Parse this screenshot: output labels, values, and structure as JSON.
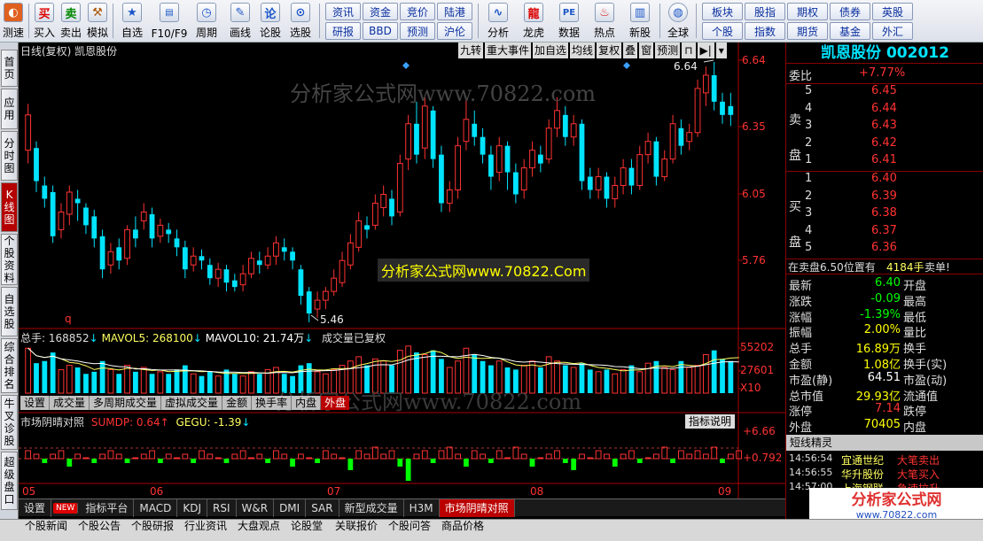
{
  "toolbar": {
    "left_buttons": [
      {
        "label": "测速",
        "icon": "speed-icon"
      },
      {
        "label": "买入",
        "icon": "buy-icon",
        "glyph": "买"
      },
      {
        "label": "卖出",
        "icon": "sell-icon",
        "glyph": "卖"
      },
      {
        "label": "模拟",
        "icon": "hammer-icon"
      },
      {
        "label": "自选",
        "icon": "star-icon"
      },
      {
        "label": "F10/F9",
        "icon": "f10-icon"
      },
      {
        "label": "周期",
        "icon": "clock-icon"
      },
      {
        "label": "画线",
        "icon": "pen-icon"
      },
      {
        "label": "论股",
        "icon": "discuss-icon",
        "glyph": "论"
      },
      {
        "label": "选股",
        "icon": "screen-stock-icon"
      }
    ],
    "panel1": [
      "资讯",
      "资金",
      "竞价",
      "陆港",
      "研报",
      "BBD",
      "预测",
      "沪伦"
    ],
    "mid_buttons": [
      {
        "label": "分析",
        "icon": "analysis-icon"
      },
      {
        "label": "龙虎",
        "icon": "dragon-tiger-icon"
      },
      {
        "label": "数据",
        "icon": "pe-data-icon",
        "glyph": "PE"
      },
      {
        "label": "热点",
        "icon": "hot-icon"
      },
      {
        "label": "新股",
        "icon": "new-stock-icon"
      },
      {
        "label": "全球",
        "icon": "globe-icon"
      }
    ],
    "panel2": [
      "板块",
      "股指",
      "期权",
      "债券",
      "英股",
      "个股",
      "指数",
      "期货",
      "基金",
      "外汇"
    ]
  },
  "left_tabs": [
    "首页",
    "应用",
    "分时图",
    "K线图",
    "个股资料",
    "自选股",
    "综合排名",
    "牛叉诊股",
    "超级盘口"
  ],
  "chart": {
    "title": "日线(复权) 凯恩股份",
    "top_buttons": [
      "九转",
      "重大事件",
      "加自选",
      "均线",
      "复权",
      "叠",
      "窗",
      "预测"
    ],
    "watermark1": "分析家公式网www.70822.com",
    "watermark2": "分析家公式网www.70822.Com",
    "watermark3": "分析家公式网www.70822.com",
    "price_labels": [
      "6.64",
      "6.35",
      "6.05",
      "5.76"
    ],
    "max_label": "6.64",
    "min_label": "5.46",
    "q_mark": "q",
    "vol_header": {
      "total": "总手: 168852",
      "mavol5": "MAVOL5: 268100",
      "mavol10": "MAVOL10: 21.74万",
      "note": "成交量已复权"
    },
    "vol_labels": [
      "55202",
      "27601",
      "X10"
    ],
    "vol_tabs": [
      "设置",
      "成交量",
      "多周期成交量",
      "虚拟成交量",
      "金额",
      "换手率",
      "内盘",
      "外盘"
    ],
    "ind_header": {
      "name": "市场阴晴对照",
      "sumdp": "SUMDP: 0.64",
      "gegu": "GEGU: -1.39"
    },
    "ind_button": "指标说明",
    "ind_labels": [
      "+6.66",
      "+0.792"
    ],
    "month_labels": [
      "05",
      "06",
      "07",
      "08",
      "09"
    ]
  },
  "chart_data": {
    "type": "candlestick",
    "ylim": [
      5.46,
      6.64
    ],
    "candles": [
      {
        "o": 6.24,
        "c": 6.4,
        "h": 6.45,
        "l": 6.18
      },
      {
        "o": 6.25,
        "c": 6.1,
        "h": 6.28,
        "l": 6.05
      },
      {
        "o": 6.08,
        "c": 6.02,
        "h": 6.12,
        "l": 5.98
      },
      {
        "o": 6.05,
        "c": 5.85,
        "h": 6.08,
        "l": 5.82
      },
      {
        "o": 5.88,
        "c": 5.96,
        "h": 6.0,
        "l": 5.84
      },
      {
        "o": 5.95,
        "c": 6.05,
        "h": 6.08,
        "l": 5.9
      },
      {
        "o": 6.02,
        "c": 6.0,
        "h": 6.06,
        "l": 5.92
      },
      {
        "o": 5.98,
        "c": 5.9,
        "h": 6.0,
        "l": 5.86
      },
      {
        "o": 5.94,
        "c": 5.84,
        "h": 5.97,
        "l": 5.8
      },
      {
        "o": 5.85,
        "c": 5.7,
        "h": 5.88,
        "l": 5.66
      },
      {
        "o": 5.72,
        "c": 5.78,
        "h": 5.82,
        "l": 5.68
      },
      {
        "o": 5.8,
        "c": 5.74,
        "h": 5.84,
        "l": 5.7
      },
      {
        "o": 5.75,
        "c": 5.88,
        "h": 5.9,
        "l": 5.72
      },
      {
        "o": 5.88,
        "c": 5.84,
        "h": 5.94,
        "l": 5.8
      },
      {
        "o": 5.92,
        "c": 5.96,
        "h": 6.0,
        "l": 5.88
      },
      {
        "o": 5.95,
        "c": 5.84,
        "h": 5.98,
        "l": 5.8
      },
      {
        "o": 5.85,
        "c": 5.9,
        "h": 5.93,
        "l": 5.82
      },
      {
        "o": 5.88,
        "c": 5.86,
        "h": 5.91,
        "l": 5.82
      },
      {
        "o": 5.84,
        "c": 5.8,
        "h": 5.88,
        "l": 5.76
      },
      {
        "o": 5.8,
        "c": 5.7,
        "h": 5.83,
        "l": 5.66
      },
      {
        "o": 5.72,
        "c": 5.76,
        "h": 5.8,
        "l": 5.69
      },
      {
        "o": 5.76,
        "c": 5.74,
        "h": 5.79,
        "l": 5.7
      },
      {
        "o": 5.72,
        "c": 5.66,
        "h": 5.75,
        "l": 5.63
      },
      {
        "o": 5.66,
        "c": 5.7,
        "h": 5.73,
        "l": 5.62
      },
      {
        "o": 5.7,
        "c": 5.64,
        "h": 5.72,
        "l": 5.6
      },
      {
        "o": 5.65,
        "c": 5.62,
        "h": 5.68,
        "l": 5.6
      },
      {
        "o": 5.63,
        "c": 5.68,
        "h": 5.72,
        "l": 5.6
      },
      {
        "o": 5.68,
        "c": 5.75,
        "h": 5.78,
        "l": 5.66
      },
      {
        "o": 5.74,
        "c": 5.72,
        "h": 5.78,
        "l": 5.68
      },
      {
        "o": 5.72,
        "c": 5.76,
        "h": 5.8,
        "l": 5.7
      },
      {
        "o": 5.76,
        "c": 5.82,
        "h": 5.85,
        "l": 5.72
      },
      {
        "o": 5.8,
        "c": 5.78,
        "h": 5.84,
        "l": 5.74
      },
      {
        "o": 5.78,
        "c": 5.74,
        "h": 5.8,
        "l": 5.7
      },
      {
        "o": 5.7,
        "c": 5.58,
        "h": 5.72,
        "l": 5.54
      },
      {
        "o": 5.6,
        "c": 5.5,
        "h": 5.62,
        "l": 5.46
      },
      {
        "o": 5.52,
        "c": 5.56,
        "h": 5.6,
        "l": 5.48
      },
      {
        "o": 5.56,
        "c": 5.6,
        "h": 5.62,
        "l": 5.52
      },
      {
        "o": 5.6,
        "c": 5.66,
        "h": 5.7,
        "l": 5.58
      },
      {
        "o": 5.64,
        "c": 5.74,
        "h": 5.78,
        "l": 5.62
      },
      {
        "o": 5.72,
        "c": 5.82,
        "h": 5.86,
        "l": 5.7
      },
      {
        "o": 5.8,
        "c": 5.92,
        "h": 5.96,
        "l": 5.78
      },
      {
        "o": 5.9,
        "c": 5.88,
        "h": 5.94,
        "l": 5.84
      },
      {
        "o": 5.9,
        "c": 6.0,
        "h": 6.04,
        "l": 5.88
      },
      {
        "o": 5.98,
        "c": 6.04,
        "h": 6.08,
        "l": 5.94
      },
      {
        "o": 6.02,
        "c": 5.94,
        "h": 6.06,
        "l": 5.9
      },
      {
        "o": 5.96,
        "c": 6.18,
        "h": 6.22,
        "l": 5.94
      },
      {
        "o": 6.2,
        "c": 6.36,
        "h": 6.4,
        "l": 6.15
      },
      {
        "o": 6.36,
        "c": 6.22,
        "h": 6.46,
        "l": 6.18
      },
      {
        "o": 6.25,
        "c": 6.44,
        "h": 6.48,
        "l": 6.2
      },
      {
        "o": 6.42,
        "c": 6.2,
        "h": 6.44,
        "l": 6.16
      },
      {
        "o": 6.22,
        "c": 6.0,
        "h": 6.26,
        "l": 5.96
      },
      {
        "o": 6.0,
        "c": 6.06,
        "h": 6.1,
        "l": 5.96
      },
      {
        "o": 6.06,
        "c": 6.26,
        "h": 6.3,
        "l": 6.02
      },
      {
        "o": 6.28,
        "c": 6.38,
        "h": 6.48,
        "l": 6.24
      },
      {
        "o": 6.36,
        "c": 6.3,
        "h": 6.42,
        "l": 6.26
      },
      {
        "o": 6.3,
        "c": 6.22,
        "h": 6.34,
        "l": 6.18
      },
      {
        "o": 6.22,
        "c": 6.12,
        "h": 6.26,
        "l": 6.06
      },
      {
        "o": 6.14,
        "c": 6.26,
        "h": 6.3,
        "l": 6.1
      },
      {
        "o": 6.26,
        "c": 6.14,
        "h": 6.28,
        "l": 6.06
      },
      {
        "o": 6.14,
        "c": 6.04,
        "h": 6.18,
        "l": 6.0
      },
      {
        "o": 6.06,
        "c": 6.16,
        "h": 6.2,
        "l": 6.02
      },
      {
        "o": 6.16,
        "c": 6.24,
        "h": 6.28,
        "l": 6.12
      },
      {
        "o": 6.22,
        "c": 6.18,
        "h": 6.26,
        "l": 6.14
      },
      {
        "o": 6.2,
        "c": 6.34,
        "h": 6.38,
        "l": 6.18
      },
      {
        "o": 6.34,
        "c": 6.42,
        "h": 6.48,
        "l": 6.3
      },
      {
        "o": 6.4,
        "c": 6.3,
        "h": 6.44,
        "l": 6.26
      },
      {
        "o": 6.3,
        "c": 6.36,
        "h": 6.4,
        "l": 6.26
      },
      {
        "o": 6.36,
        "c": 6.1,
        "h": 6.38,
        "l": 6.06
      },
      {
        "o": 6.12,
        "c": 6.06,
        "h": 6.16,
        "l": 6.02
      },
      {
        "o": 6.06,
        "c": 6.12,
        "h": 6.16,
        "l": 6.02
      },
      {
        "o": 6.12,
        "c": 6.02,
        "h": 6.14,
        "l": 5.98
      },
      {
        "o": 6.02,
        "c": 6.08,
        "h": 6.12,
        "l": 5.98
      },
      {
        "o": 6.08,
        "c": 6.16,
        "h": 6.2,
        "l": 6.04
      },
      {
        "o": 6.16,
        "c": 6.08,
        "h": 6.2,
        "l": 6.04
      },
      {
        "o": 6.08,
        "c": 6.22,
        "h": 6.26,
        "l": 6.06
      },
      {
        "o": 6.22,
        "c": 6.28,
        "h": 6.32,
        "l": 6.18
      },
      {
        "o": 6.28,
        "c": 6.12,
        "h": 6.3,
        "l": 6.08
      },
      {
        "o": 6.12,
        "c": 6.2,
        "h": 6.24,
        "l": 6.1
      },
      {
        "o": 6.2,
        "c": 6.36,
        "h": 6.4,
        "l": 6.18
      },
      {
        "o": 6.34,
        "c": 6.26,
        "h": 6.38,
        "l": 6.22
      },
      {
        "o": 6.28,
        "c": 6.32,
        "h": 6.36,
        "l": 6.24
      },
      {
        "o": 6.32,
        "c": 6.52,
        "h": 6.56,
        "l": 6.3
      },
      {
        "o": 6.5,
        "c": 6.58,
        "h": 6.62,
        "l": 6.44
      },
      {
        "o": 6.58,
        "c": 6.46,
        "h": 6.64,
        "l": 6.42
      },
      {
        "o": 6.46,
        "c": 6.4,
        "h": 6.5,
        "l": 6.36
      },
      {
        "o": 6.44,
        "c": 6.4,
        "h": 6.5,
        "l": 6.35
      }
    ],
    "volumes": [
      42,
      28,
      30,
      38,
      22,
      26,
      24,
      18,
      20,
      30,
      22,
      18,
      26,
      20,
      24,
      18,
      20,
      18,
      22,
      26,
      18,
      16,
      20,
      16,
      22,
      18,
      16,
      20,
      18,
      22,
      24,
      18,
      16,
      26,
      28,
      20,
      18,
      22,
      26,
      30,
      34,
      26,
      32,
      30,
      26,
      40,
      44,
      38,
      36,
      40,
      32,
      24,
      30,
      42,
      36,
      30,
      26,
      30,
      24,
      22,
      26,
      30,
      24,
      34,
      30,
      26,
      24,
      28,
      22,
      20,
      22,
      18,
      22,
      26,
      20,
      28,
      30,
      24,
      22,
      30,
      24,
      26,
      36,
      40,
      32,
      30,
      28
    ],
    "indicator": [
      2,
      1,
      -1,
      1,
      2,
      -2,
      1,
      0,
      -1,
      1,
      2,
      1,
      -1,
      0,
      1,
      2,
      -1,
      1,
      0,
      1,
      -1,
      2,
      1,
      0,
      -1,
      1,
      2,
      0,
      1,
      -1,
      2,
      1,
      -2,
      1,
      0,
      -1,
      2,
      1,
      0,
      -3,
      2,
      1,
      3,
      1,
      2,
      -2,
      -6,
      1,
      2,
      -1,
      2,
      3,
      1,
      -2,
      2,
      1,
      -1,
      2,
      0,
      3,
      1,
      -2,
      0,
      1,
      2,
      -1,
      -3,
      1,
      0,
      2,
      1,
      -2,
      1,
      2,
      -1,
      0,
      1,
      3,
      -1,
      2,
      1,
      2,
      1,
      3,
      -1,
      1,
      2
    ]
  },
  "quote": {
    "stock_title": "凯恩股份 002012",
    "weibi_label": "委比",
    "weibi_value": "+7.77%",
    "sell_label": "卖盘",
    "buy_label": "买盘",
    "asks": [
      {
        "level": "5",
        "price": "6.45"
      },
      {
        "level": "4",
        "price": "6.44"
      },
      {
        "level": "3",
        "price": "6.43"
      },
      {
        "level": "2",
        "price": "6.42"
      },
      {
        "level": "1",
        "price": "6.41"
      }
    ],
    "bids": [
      {
        "level": "1",
        "price": "6.40"
      },
      {
        "level": "2",
        "price": "6.39"
      },
      {
        "level": "3",
        "price": "6.38"
      },
      {
        "level": "4",
        "price": "6.37"
      },
      {
        "level": "5",
        "price": "6.36"
      }
    ],
    "notice": "在卖盘6.50位置有",
    "notice_qty": "4184手",
    "notice_tag": "卖单!",
    "stats": [
      {
        "k1": "最新",
        "v1": "6.40",
        "k2": "开盘",
        "c": "#00ff00"
      },
      {
        "k1": "涨跌",
        "v1": "-0.09",
        "k2": "最高",
        "c": "#00ff00"
      },
      {
        "k1": "涨幅",
        "v1": "-1.39%",
        "k2": "最低",
        "c": "#00ff00"
      },
      {
        "k1": "振幅",
        "v1": "2.00%",
        "k2": "量比",
        "c": "#ffff00"
      },
      {
        "k1": "总手",
        "v1": "16.89万",
        "k2": "换手",
        "c": "#ffff00"
      },
      {
        "k1": "金额",
        "v1": "1.08亿",
        "k2": "换手(实)",
        "c": "#ffff00"
      },
      {
        "k1": "市盈(静)",
        "v1": "64.51",
        "k2": "市盈(动)",
        "c": "#ffffff"
      },
      {
        "k1": "总市值",
        "v1": "29.93亿",
        "k2": "流通值",
        "c": "#ffff00"
      },
      {
        "k1": "涨停",
        "v1": "7.14",
        "k2": "跌停",
        "c": "#ff3333"
      },
      {
        "k1": "外盘",
        "v1": "70405",
        "k2": "内盘",
        "c": "#ffff00"
      }
    ],
    "short_title": "短线精灵",
    "short_items": [
      {
        "time": "14:56:54",
        "name": "宜通世纪",
        "event": "大笔卖出"
      },
      {
        "time": "14:56:55",
        "name": "华升股份",
        "event": "大笔买入"
      },
      {
        "time": "14:57:00",
        "name": "上海钢联",
        "event": "急速拉升"
      }
    ],
    "logo_text": "分析家公式网",
    "logo_url": "www.70822.com"
  },
  "bottom_tabs": [
    "设置",
    "NEW",
    "指标平台",
    "MACD",
    "KDJ",
    "RSI",
    "W&R",
    "DMI",
    "SAR",
    "新型成交量",
    "H3M",
    "市场阴晴对照"
  ],
  "bottom_bar": [
    "个股新闻",
    "个股公告",
    "个股研报",
    "行业资讯",
    "大盘观点",
    "论股堂",
    "关联报价",
    "个股问答",
    "商品价格"
  ],
  "colors": {
    "up": "#ff3232",
    "down": "#00e4ff",
    "accent": "#b40000"
  }
}
